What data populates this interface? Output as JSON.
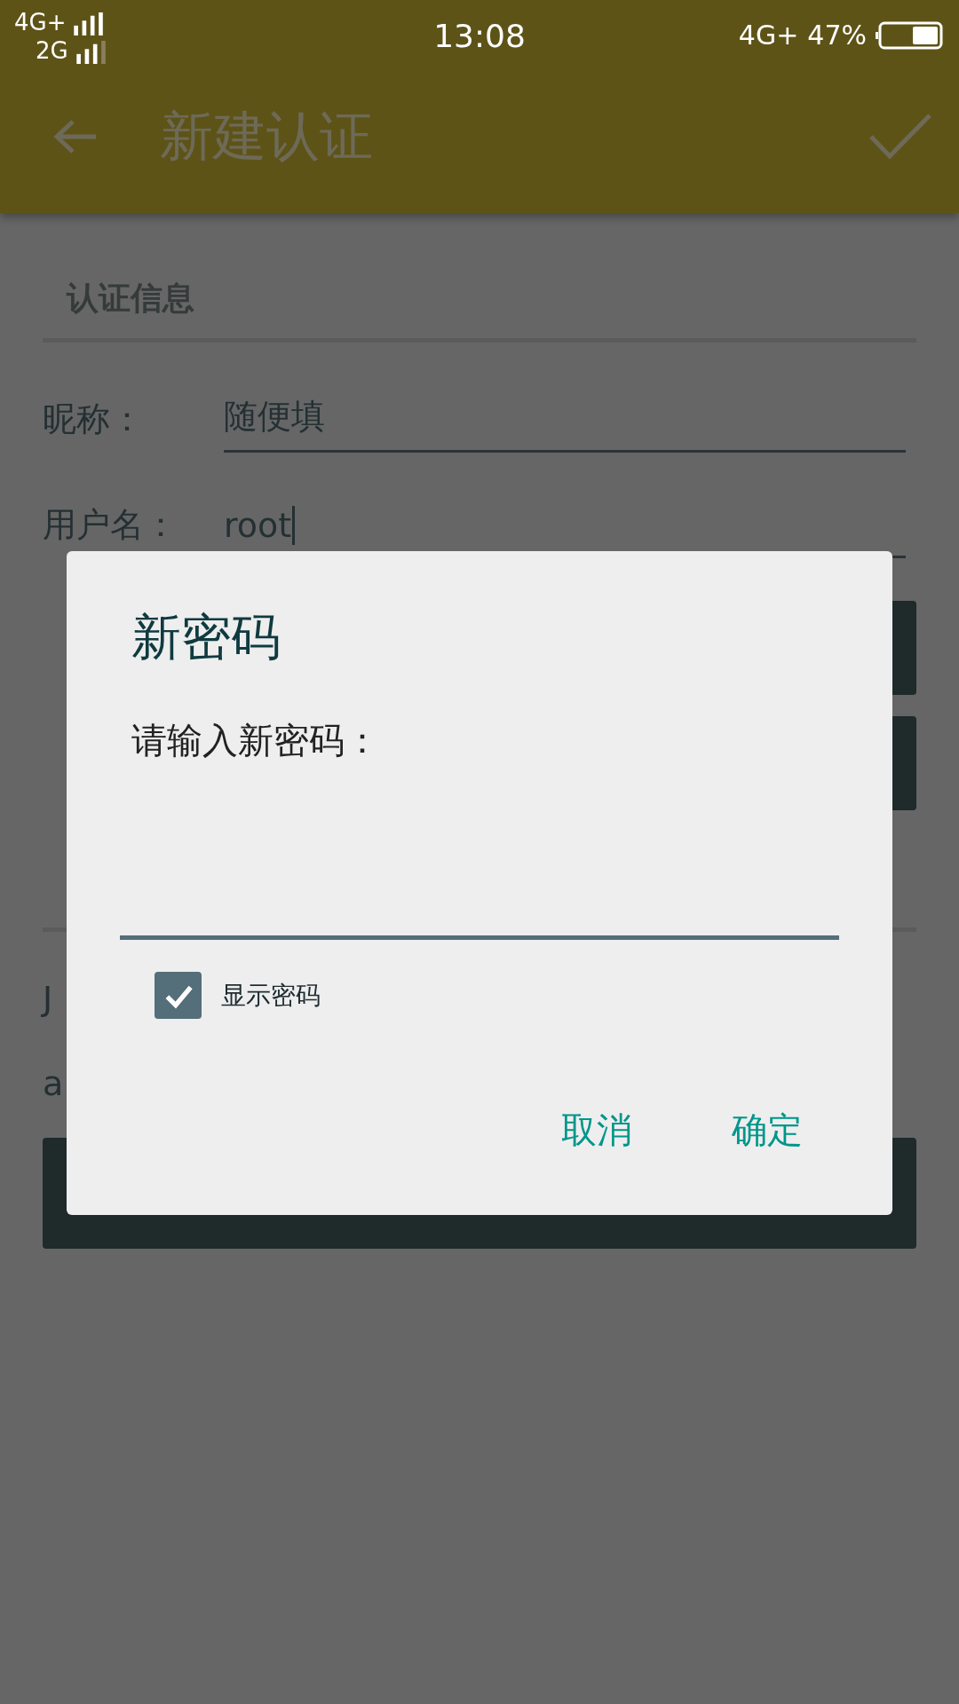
{
  "status_bar": {
    "network_1": "4G+",
    "network_2": "2G",
    "time": "13:08",
    "network_3": "4G+",
    "battery": "47%"
  },
  "app_bar": {
    "title": "新建认证"
  },
  "section": {
    "title": "认证信息"
  },
  "fields": [
    {
      "label": "昵称：",
      "value": "随便填",
      "focused": false
    },
    {
      "label": "用户名：",
      "value": "root",
      "focused": true
    }
  ],
  "note_lines": [
    "J",
    "a"
  ],
  "dialog": {
    "title": "新密码",
    "message": "请输入新密码：",
    "show_password": {
      "label": "显示密码",
      "checked": true
    },
    "buttons": [
      "取消",
      "确定"
    ]
  }
}
